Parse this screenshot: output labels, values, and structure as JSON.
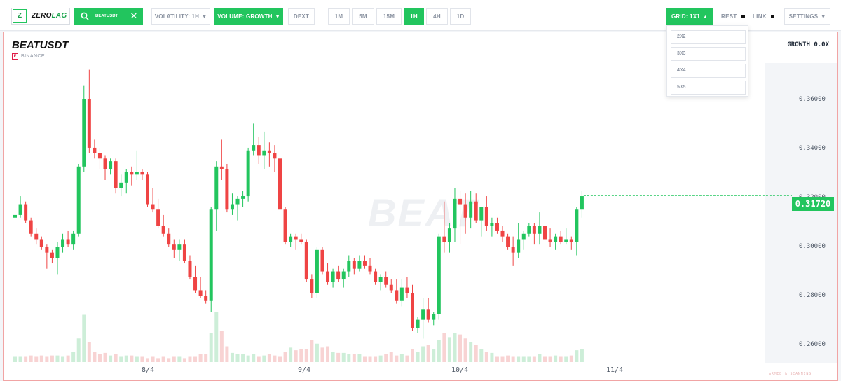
{
  "app": {
    "logo_letter": "Z",
    "logo_part1": "ZERO",
    "logo_part2": "LAG"
  },
  "toolbar": {
    "search": {
      "value": "BEATUSDT",
      "clear_label": "✕"
    },
    "volatility_label": "VOLATILITY: 1H",
    "volume_label": "VOLUME: GROWTH",
    "dext_label": "DEXT",
    "timeframes": [
      "1M",
      "5M",
      "15M",
      "1H",
      "4H",
      "1D"
    ],
    "active_timeframe": "1H",
    "grid_label": "GRID: 1X1",
    "rest_label": "REST",
    "link_label": "LINK",
    "settings_label": "SETTINGS"
  },
  "grid_menu": {
    "options": [
      "2X2",
      "3X3",
      "4X4",
      "5X5"
    ]
  },
  "chart": {
    "symbol": "BEATUSDT",
    "exchange_badge": "F",
    "exchange": "BINANCE",
    "growth": "GROWTH 0.0X",
    "watermark": "BEAT",
    "last_price": "0.31720",
    "footer": "ARMED & SCANNING"
  },
  "colors": {
    "up": "#22c55e",
    "down": "#ef4444",
    "accent": "#22c55e"
  },
  "chart_data": {
    "type": "candlestick",
    "y_ticks": [
      "0.36000",
      "0.34000",
      "0.32000",
      "0.30000",
      "0.28000",
      "0.26000"
    ],
    "x_ticks": [
      "8/4",
      "9/4",
      "10/4",
      "11/4"
    ],
    "ylim": [
      0.2545,
      0.3665
    ],
    "last_price": 0.3172,
    "ohlc": [
      [
        0.309,
        0.313,
        0.305,
        0.31
      ],
      [
        0.31,
        0.317,
        0.309,
        0.314
      ],
      [
        0.314,
        0.315,
        0.307,
        0.308
      ],
      [
        0.308,
        0.309,
        0.302,
        0.303
      ],
      [
        0.303,
        0.305,
        0.299,
        0.301
      ],
      [
        0.301,
        0.302,
        0.297,
        0.298
      ],
      [
        0.298,
        0.299,
        0.29,
        0.296
      ],
      [
        0.296,
        0.297,
        0.292,
        0.294
      ],
      [
        0.294,
        0.3,
        0.288,
        0.298
      ],
      [
        0.298,
        0.303,
        0.296,
        0.301
      ],
      [
        0.301,
        0.304,
        0.298,
        0.299
      ],
      [
        0.299,
        0.304,
        0.297,
        0.303
      ],
      [
        0.303,
        0.329,
        0.302,
        0.328
      ],
      [
        0.328,
        0.358,
        0.326,
        0.353
      ],
      [
        0.353,
        0.364,
        0.333,
        0.335
      ],
      [
        0.335,
        0.338,
        0.331,
        0.333
      ],
      [
        0.333,
        0.335,
        0.327,
        0.331
      ],
      [
        0.331,
        0.332,
        0.323,
        0.327
      ],
      [
        0.327,
        0.331,
        0.325,
        0.33
      ],
      [
        0.33,
        0.331,
        0.318,
        0.32
      ],
      [
        0.32,
        0.325,
        0.317,
        0.322
      ],
      [
        0.322,
        0.327,
        0.318,
        0.326
      ],
      [
        0.326,
        0.328,
        0.321,
        0.325
      ],
      [
        0.325,
        0.334,
        0.323,
        0.326
      ],
      [
        0.326,
        0.327,
        0.323,
        0.325
      ],
      [
        0.325,
        0.326,
        0.313,
        0.314
      ],
      [
        0.314,
        0.32,
        0.311,
        0.312
      ],
      [
        0.312,
        0.316,
        0.305,
        0.306
      ],
      [
        0.306,
        0.31,
        0.302,
        0.303
      ],
      [
        0.303,
        0.305,
        0.298,
        0.299
      ],
      [
        0.299,
        0.301,
        0.294,
        0.297
      ],
      [
        0.297,
        0.301,
        0.293,
        0.299
      ],
      [
        0.299,
        0.301,
        0.292,
        0.293
      ],
      [
        0.293,
        0.295,
        0.286,
        0.287
      ],
      [
        0.287,
        0.291,
        0.281,
        0.282
      ],
      [
        0.282,
        0.287,
        0.279,
        0.28
      ],
      [
        0.28,
        0.282,
        0.277,
        0.278
      ],
      [
        0.278,
        0.313,
        0.274,
        0.312
      ],
      [
        0.312,
        0.33,
        0.304,
        0.328
      ],
      [
        0.328,
        0.338,
        0.323,
        0.327
      ],
      [
        0.327,
        0.329,
        0.311,
        0.312
      ],
      [
        0.312,
        0.318,
        0.31,
        0.314
      ],
      [
        0.314,
        0.317,
        0.308,
        0.316
      ],
      [
        0.316,
        0.319,
        0.313,
        0.317
      ],
      [
        0.317,
        0.335,
        0.315,
        0.334
      ],
      [
        0.334,
        0.344,
        0.332,
        0.336
      ],
      [
        0.336,
        0.339,
        0.329,
        0.332
      ],
      [
        0.332,
        0.341,
        0.327,
        0.334
      ],
      [
        0.334,
        0.337,
        0.328,
        0.333
      ],
      [
        0.333,
        0.336,
        0.326,
        0.331
      ],
      [
        0.331,
        0.334,
        0.311,
        0.312
      ],
      [
        0.312,
        0.313,
        0.299,
        0.3
      ],
      [
        0.3,
        0.303,
        0.298,
        0.302
      ],
      [
        0.302,
        0.303,
        0.297,
        0.301
      ],
      [
        0.301,
        0.303,
        0.299,
        0.3
      ],
      [
        0.3,
        0.301,
        0.285,
        0.286
      ],
      [
        0.286,
        0.288,
        0.279,
        0.281
      ],
      [
        0.281,
        0.298,
        0.279,
        0.297
      ],
      [
        0.297,
        0.298,
        0.288,
        0.289
      ],
      [
        0.289,
        0.292,
        0.284,
        0.285
      ],
      [
        0.285,
        0.29,
        0.283,
        0.289
      ],
      [
        0.289,
        0.291,
        0.285,
        0.286
      ],
      [
        0.286,
        0.29,
        0.283,
        0.289
      ],
      [
        0.289,
        0.295,
        0.287,
        0.293
      ],
      [
        0.293,
        0.294,
        0.288,
        0.29
      ],
      [
        0.29,
        0.295,
        0.289,
        0.293
      ],
      [
        0.293,
        0.295,
        0.29,
        0.291
      ],
      [
        0.291,
        0.294,
        0.288,
        0.289
      ],
      [
        0.289,
        0.29,
        0.284,
        0.285
      ],
      [
        0.285,
        0.288,
        0.282,
        0.287
      ],
      [
        0.287,
        0.289,
        0.283,
        0.284
      ],
      [
        0.284,
        0.286,
        0.281,
        0.282
      ],
      [
        0.282,
        0.286,
        0.277,
        0.278
      ],
      [
        0.278,
        0.286,
        0.276,
        0.283
      ],
      [
        0.283,
        0.287,
        0.279,
        0.281
      ],
      [
        0.281,
        0.284,
        0.267,
        0.268
      ],
      [
        0.268,
        0.272,
        0.266,
        0.271
      ],
      [
        0.271,
        0.279,
        0.264,
        0.275
      ],
      [
        0.275,
        0.279,
        0.27,
        0.271
      ],
      [
        0.271,
        0.274,
        0.269,
        0.273
      ],
      [
        0.273,
        0.303,
        0.271,
        0.302
      ],
      [
        0.302,
        0.315,
        0.296,
        0.3
      ],
      [
        0.3,
        0.307,
        0.296,
        0.305
      ],
      [
        0.305,
        0.32,
        0.3,
        0.316
      ],
      [
        0.316,
        0.319,
        0.299,
        0.314
      ],
      [
        0.314,
        0.318,
        0.303,
        0.309
      ],
      [
        0.309,
        0.319,
        0.305,
        0.315
      ],
      [
        0.315,
        0.318,
        0.307,
        0.308
      ],
      [
        0.308,
        0.312,
        0.302,
        0.313
      ],
      [
        0.313,
        0.317,
        0.304,
        0.306
      ],
      [
        0.306,
        0.309,
        0.302,
        0.307
      ],
      [
        0.307,
        0.309,
        0.303,
        0.304
      ],
      [
        0.304,
        0.306,
        0.3,
        0.302
      ],
      [
        0.302,
        0.303,
        0.297,
        0.298
      ],
      [
        0.298,
        0.302,
        0.291,
        0.296
      ],
      [
        0.296,
        0.307,
        0.294,
        0.301
      ],
      [
        0.301,
        0.304,
        0.297,
        0.303
      ],
      [
        0.303,
        0.307,
        0.302,
        0.306
      ],
      [
        0.306,
        0.307,
        0.299,
        0.303
      ],
      [
        0.303,
        0.311,
        0.299,
        0.306
      ],
      [
        0.306,
        0.308,
        0.3,
        0.301
      ],
      [
        0.301,
        0.305,
        0.298,
        0.3
      ],
      [
        0.3,
        0.303,
        0.297,
        0.302
      ],
      [
        0.302,
        0.304,
        0.299,
        0.3
      ],
      [
        0.3,
        0.305,
        0.299,
        0.301
      ],
      [
        0.301,
        0.302,
        0.297,
        0.3
      ],
      [
        0.3,
        0.313,
        0.295,
        0.312
      ],
      [
        0.312,
        0.319,
        0.309,
        0.317
      ]
    ],
    "volume": [
      4,
      4,
      4,
      5,
      4,
      5,
      4,
      5,
      5,
      4,
      5,
      8,
      18,
      36,
      15,
      8,
      6,
      7,
      5,
      6,
      4,
      5,
      5,
      4,
      4,
      3,
      4,
      3,
      4,
      3,
      4,
      4,
      3,
      4,
      4,
      6,
      6,
      22,
      38,
      24,
      12,
      7,
      6,
      6,
      5,
      6,
      4,
      5,
      6,
      5,
      4,
      8,
      11,
      9,
      10,
      10,
      17,
      14,
      11,
      12,
      8,
      7,
      7,
      6,
      6,
      6,
      4,
      4,
      4,
      5,
      6,
      8,
      5,
      6,
      5,
      10,
      8,
      12,
      13,
      10,
      17,
      22,
      19,
      22,
      21,
      18,
      15,
      13,
      10,
      8,
      7,
      4,
      4,
      5,
      4,
      4,
      4,
      4,
      4,
      6,
      4,
      4,
      5,
      4,
      4,
      5,
      9,
      10
    ]
  }
}
